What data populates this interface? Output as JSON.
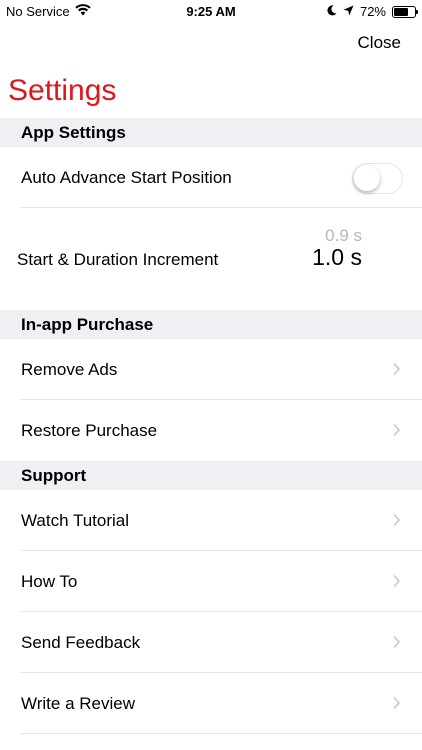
{
  "status_bar": {
    "carrier": "No Service",
    "time": "9:25 AM",
    "battery": "72%",
    "icons": [
      "wifi-icon",
      "moon-icon",
      "location-arrow-icon",
      "battery-icon"
    ]
  },
  "header": {
    "close_label": "Close",
    "title": "Settings",
    "title_color": "#e0161b"
  },
  "sections": {
    "app_settings": {
      "title": "App Settings",
      "auto_advance": {
        "label": "Auto Advance Start Position",
        "enabled": false
      },
      "increment": {
        "label": "Start & Duration Increment",
        "previous": "0.9 s",
        "value": "1.0 s"
      }
    },
    "purchase": {
      "title": "In-app Purchase",
      "items": [
        "Remove Ads",
        "Restore Purchase"
      ]
    },
    "support": {
      "title": "Support",
      "items": [
        "Watch Tutorial",
        "How To",
        "Send Feedback",
        "Write a Review"
      ]
    }
  }
}
